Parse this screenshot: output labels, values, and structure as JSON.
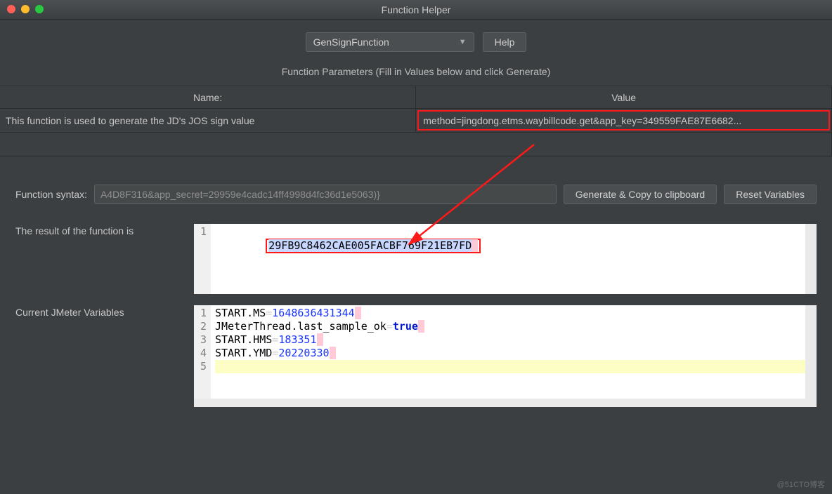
{
  "window": {
    "title": "Function Helper"
  },
  "top": {
    "function_select": "GenSignFunction",
    "help_btn": "Help"
  },
  "params": {
    "header": "Function Parameters (Fill in Values below and click Generate)",
    "col_name": "Name:",
    "col_value": "Value",
    "rows": [
      {
        "name": "This function is used to generate the JD's JOS sign value",
        "value": "method=jingdong.etms.waybillcode.get&app_key=349559FAE87E6682..."
      }
    ]
  },
  "syntax": {
    "label": "Function syntax:",
    "value": "A4D8F316&app_secret=29959e4cadc14ff4998d4fc36d1e5063)}",
    "generate_btn": "Generate & Copy to clipboard",
    "reset_btn": "Reset Variables"
  },
  "result": {
    "label": "The result of the function is",
    "line_numbers": [
      "1"
    ],
    "value": "29FB9C8462CAE005FACBF769F21EB7FD"
  },
  "vars": {
    "label": "Current JMeter Variables",
    "line_numbers": [
      "1",
      "2",
      "3",
      "4",
      "5"
    ],
    "lines": [
      {
        "key": "START.MS",
        "value": "1648636431344",
        "type": "num"
      },
      {
        "key": "JMeterThread.last_sample_ok",
        "value": "true",
        "type": "bool"
      },
      {
        "key": "START.HMS",
        "value": "183351",
        "type": "num"
      },
      {
        "key": "START.YMD",
        "value": "20220330",
        "type": "num"
      }
    ]
  },
  "watermark": "@51CTO博客"
}
